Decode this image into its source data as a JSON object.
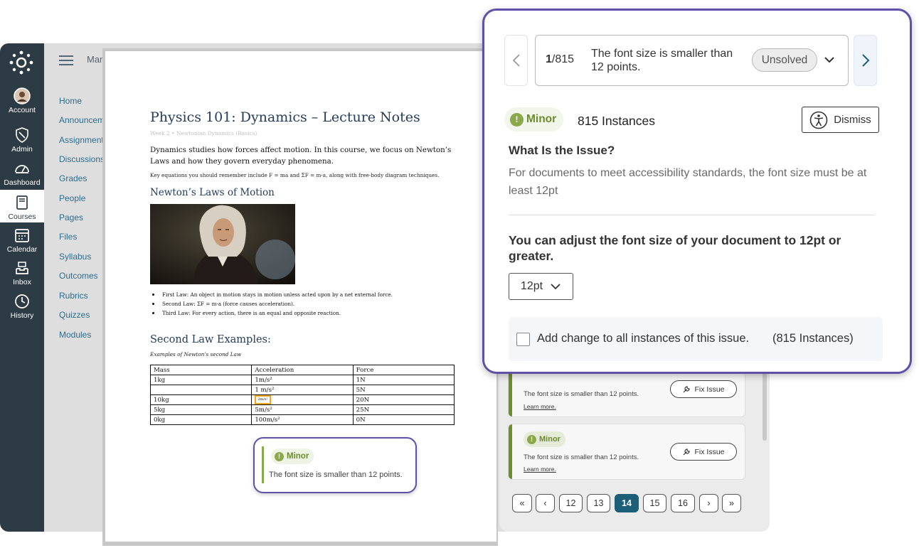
{
  "global_nav": {
    "items": [
      {
        "label": "Account",
        "icon": "avatar"
      },
      {
        "label": "Admin",
        "icon": "shield-icon"
      },
      {
        "label": "Dashboard",
        "icon": "dashboard-icon"
      },
      {
        "label": "Courses",
        "icon": "book-icon",
        "active": true
      },
      {
        "label": "Calendar",
        "icon": "calendar-icon"
      },
      {
        "label": "Inbox",
        "icon": "inbox-icon"
      },
      {
        "label": "History",
        "icon": "clock-icon"
      }
    ]
  },
  "breadcrumb": "Mar",
  "course_nav": [
    "Home",
    "Announcem",
    "Assignments",
    "Discussions",
    "Grades",
    "People",
    "Pages",
    "Files",
    "Syllabus",
    "Outcomes",
    "Rubrics",
    "Quizzes",
    "Modules"
  ],
  "document": {
    "title": "Physics 101: Dynamics – Lecture Notes",
    "subtitle": "Week 2 • Newtonian Dynamics (Basics)",
    "intro": "Dynamics studies how forces affect motion. In this course, we focus on Newton’s Laws and how they govern everyday phenomena.",
    "key_equations": "Key equations you should remember include F = ma and ΣF = m·a, along with free-body diagram techniques.",
    "laws_heading": "Newton’s Laws of Motion",
    "laws": [
      "First Law: An object in motion stays in motion unless acted upon by a net external force.",
      "Second Law: ΣF = m·a (force causes acceleration).",
      "Third Law: For every action, there is an equal and opposite reaction."
    ],
    "examples_heading": "Second Law Examples:",
    "examples_caption": "Examples of Newton's second Law",
    "table": {
      "headers": [
        "Mass",
        "Acceleration",
        "Force"
      ],
      "rows": [
        [
          "1kg",
          "1m/s²",
          "1N"
        ],
        [
          "",
          "1 m/s²",
          "5N"
        ],
        [
          "10kg",
          "2m/s²",
          "20N"
        ],
        [
          "5kg",
          "5m/s²",
          "25N"
        ],
        [
          "0kg",
          "100m/s²",
          "0N"
        ]
      ]
    }
  },
  "tooltip": {
    "severity": "Minor",
    "message": "The font size is smaller than 12 points."
  },
  "issue_list": {
    "cards": [
      {
        "severity": "Minor",
        "message": "The font size is smaller than 12 points.",
        "learn_more": "Learn more.",
        "fix_label": "Fix Issue"
      },
      {
        "severity": "Minor",
        "message": "The font size is smaller than 12 points.",
        "learn_more": "Learn more.",
        "fix_label": "Fix Issue"
      }
    ],
    "pagination": {
      "first": "«",
      "prev": "‹",
      "pages": [
        "12",
        "13",
        "14",
        "15",
        "16"
      ],
      "current": "14",
      "next": "›",
      "last": "»"
    }
  },
  "panel": {
    "counter_current": "1",
    "counter_total": "/815",
    "issue_title": "The font size is smaller than 12 points.",
    "status": "Unsolved",
    "severity": "Minor",
    "instances": "815 Instances",
    "dismiss_label": "Dismiss",
    "question": "What Is the Issue?",
    "description": "For documents to meet accessibility standards, the font size must be at least 12pt",
    "action": "You can adjust the font size of your document to 12pt or greater.",
    "font_size_value": "12pt",
    "apply_all_label": "Add change to all instances of this issue.",
    "apply_all_count": "(815 Instances)"
  },
  "colors": {
    "nav_bg": "#2d3b45",
    "accent_purple": "#6150a8",
    "minor_green": "#8ba94a",
    "page_current": "#1d5e78",
    "link_blue": "#2c6d8e"
  }
}
